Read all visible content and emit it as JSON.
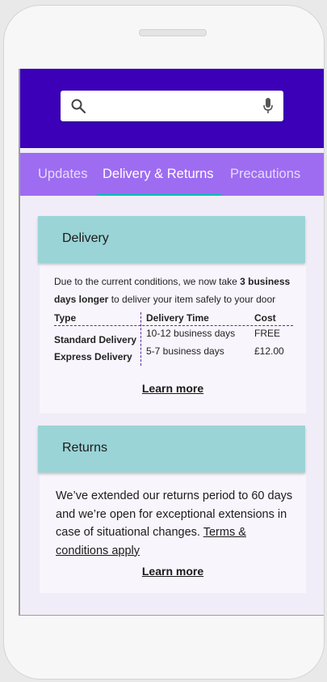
{
  "search": {
    "placeholder": ""
  },
  "tabs": [
    {
      "label": "Updates"
    },
    {
      "label": "Delivery & Returns"
    },
    {
      "label": "Precautions"
    }
  ],
  "active_tab": "Delivery & Returns",
  "delivery": {
    "title": "Delivery",
    "intro_pre": "Due to the current conditions, we now take ",
    "intro_bold": "3 business days longer",
    "intro_post": " to deliver your item safely to your door",
    "table": {
      "headers": [
        "Type",
        "Delivery Time",
        "Cost"
      ],
      "rows": [
        [
          "Standard Delivery",
          "10-12 business days",
          "FREE"
        ],
        [
          "Express Delivery",
          "5-7 business days",
          "£12.00"
        ]
      ]
    },
    "learn_more": "Learn more"
  },
  "returns": {
    "title": "Returns",
    "text": "We’ve extended our returns period to 60 days and we’re open for exceptional extensions in case of situational changes. ",
    "terms_link": "Terms & conditions apply",
    "learn_more": "Learn more"
  },
  "colors": {
    "header": "#3b00b8",
    "tabs": "#9e6cf1",
    "tab_indicator": "#14b8bd",
    "card_head": "#9bd4d6",
    "background": "#f1edf8"
  }
}
